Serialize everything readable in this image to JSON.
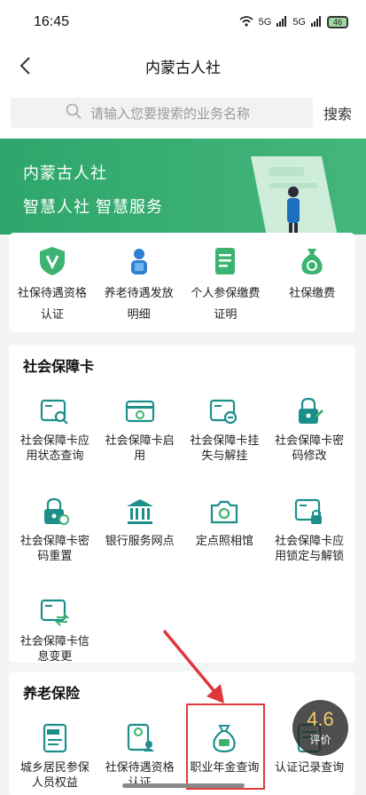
{
  "status": {
    "time": "16:45",
    "net1": "5G",
    "net2": "5G",
    "battery": "46"
  },
  "nav": {
    "title": "内蒙古人社"
  },
  "search": {
    "placeholder": "请输入您要搜索的业务名称",
    "button": "搜索"
  },
  "banner": {
    "line1": "内蒙古人社",
    "line2": "智慧人社 智慧服务"
  },
  "quick": [
    {
      "label": "社保待遇资格认证",
      "icon": "shield-v-icon"
    },
    {
      "label": "养老待遇发放明细",
      "icon": "worker-icon"
    },
    {
      "label": "个人参保缴费证明",
      "icon": "document-icon"
    },
    {
      "label": "社保缴费",
      "icon": "money-bag-icon"
    }
  ],
  "ssc": {
    "title": "社会保障卡",
    "items": [
      {
        "label": "社会保障卡应用状态查询",
        "icon": "card-search-icon"
      },
      {
        "label": "社会保障卡启用",
        "icon": "card-activate-icon"
      },
      {
        "label": "社会保障卡挂失与解挂",
        "icon": "card-loss-icon"
      },
      {
        "label": "社会保障卡密码修改",
        "icon": "lock-edit-icon"
      },
      {
        "label": "社会保障卡密码重置",
        "icon": "lock-reset-icon"
      },
      {
        "label": "银行服务网点",
        "icon": "bank-icon"
      },
      {
        "label": "定点照相馆",
        "icon": "camera-icon"
      },
      {
        "label": "社会保障卡应用锁定与解锁",
        "icon": "card-lock-icon"
      },
      {
        "label": "社会保障卡信息变更",
        "icon": "card-change-icon"
      }
    ]
  },
  "pension": {
    "title": "养老保险",
    "items": [
      {
        "label": "城乡居民参保人员权益",
        "icon": "rural-doc-icon"
      },
      {
        "label": "社保待遇资格认证",
        "icon": "cert-person-icon"
      },
      {
        "label": "职业年金查询",
        "icon": "annuity-bag-icon"
      },
      {
        "label": "认证记录查询",
        "icon": "record-icon"
      }
    ]
  },
  "rating": {
    "score": "4.6",
    "label": "评价"
  },
  "colors": {
    "brand": "#2ea66b",
    "icon": "#1d8f8b",
    "highlight": "#e0373c"
  }
}
